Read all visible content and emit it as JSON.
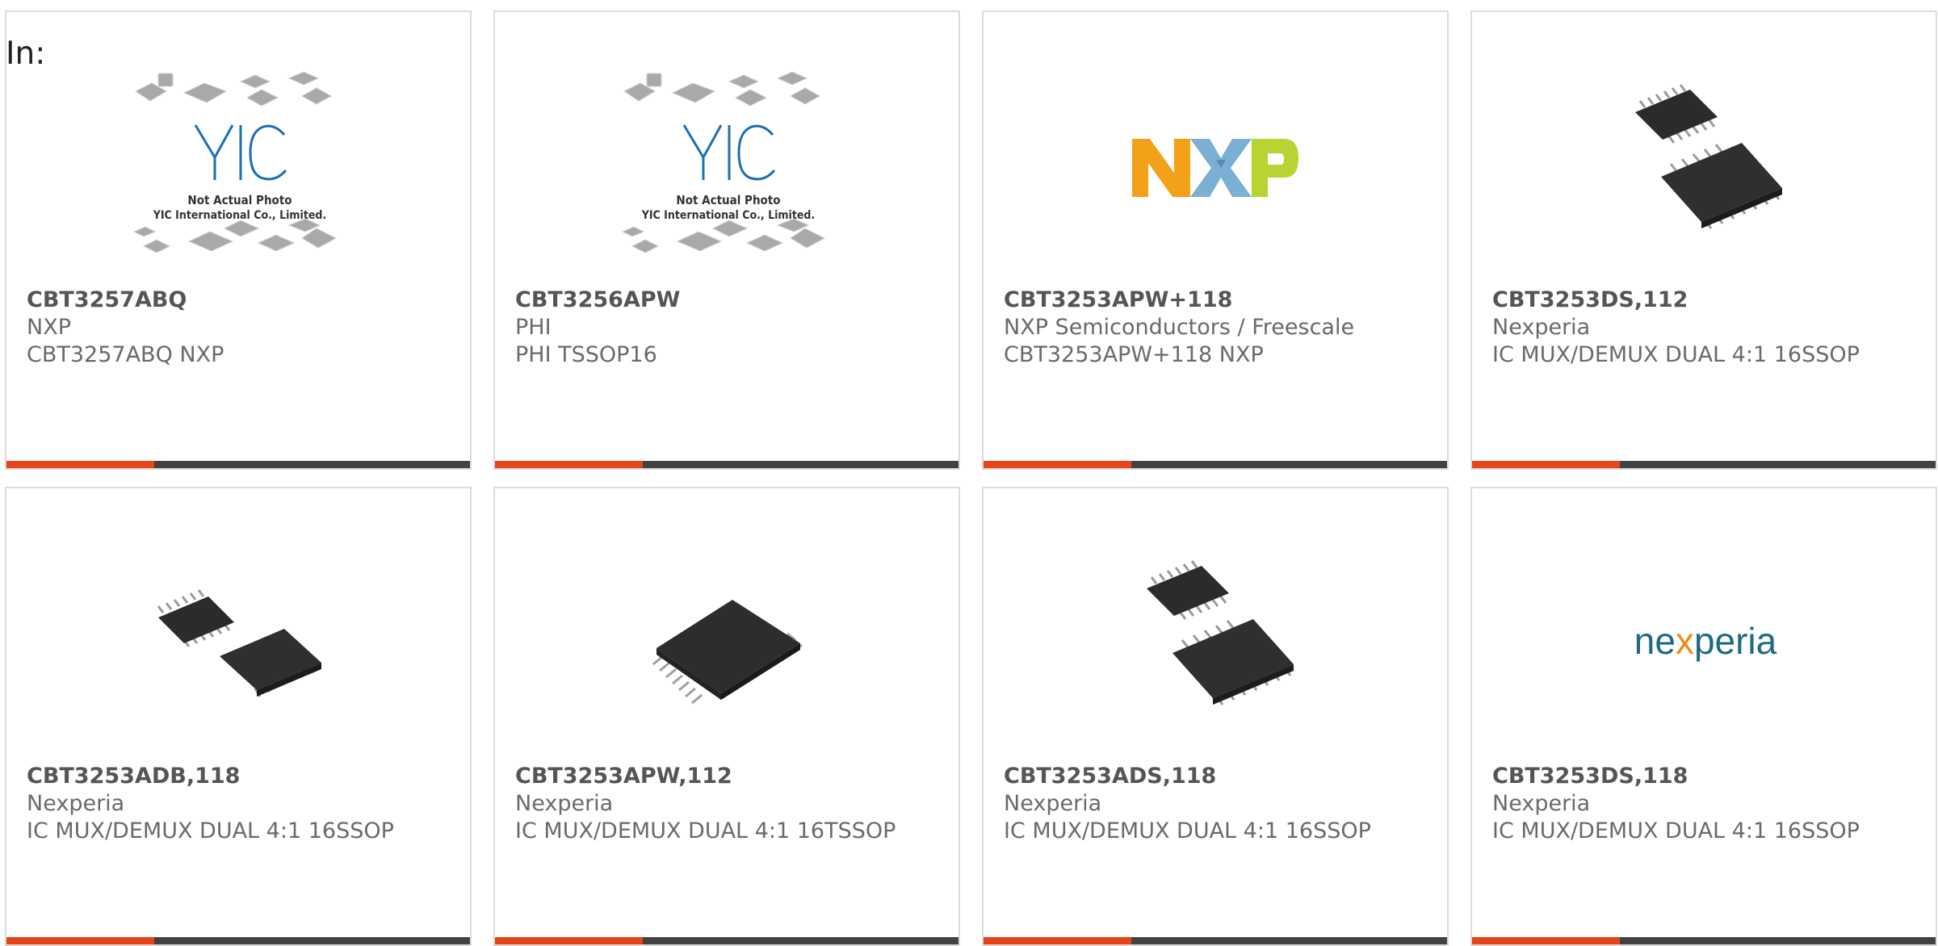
{
  "page": {
    "filter_label": "In:"
  },
  "accent_color": "#e8441a",
  "bar_color": "#424242",
  "products": [
    {
      "part": "CBT3257ABQ",
      "manufacturer": "NXP",
      "description": "CBT3257ABQ NXP",
      "image": "yic-placeholder",
      "placeholder": {
        "brand": "YIC",
        "line1": "Not Actual Photo",
        "line2": "YIC International Co., Limited."
      }
    },
    {
      "part": "CBT3256APW",
      "manufacturer": "PHI",
      "description": "PHI TSSOP16",
      "image": "yic-placeholder",
      "placeholder": {
        "brand": "YIC",
        "line1": "Not Actual Photo",
        "line2": "YIC International Co., Limited."
      }
    },
    {
      "part": "CBT3253APW+118",
      "manufacturer": "NXP Semiconductors / Freescale",
      "description": "CBT3253APW+118 NXP",
      "image": "nxp-logo",
      "logo_text": "NXP"
    },
    {
      "part": "CBT3253DS,112",
      "manufacturer": "Nexperia",
      "description": "IC MUX/DEMUX DUAL 4:1 16SSOP",
      "image": "ssop-two-chips"
    },
    {
      "part": "CBT3253ADB,118",
      "manufacturer": "Nexperia",
      "description": "IC MUX/DEMUX DUAL 4:1 16SSOP",
      "image": "ssop-two-chips-side"
    },
    {
      "part": "CBT3253APW,112",
      "manufacturer": "Nexperia",
      "description": "IC MUX/DEMUX DUAL 4:1 16TSSOP",
      "image": "tssop-single-chip"
    },
    {
      "part": "CBT3253ADS,118",
      "manufacturer": "Nexperia",
      "description": "IC MUX/DEMUX DUAL 4:1 16SSOP",
      "image": "ssop-two-chips"
    },
    {
      "part": "CBT3253DS,118",
      "manufacturer": "Nexperia",
      "description": "IC MUX/DEMUX DUAL 4:1 16SSOP",
      "image": "nexperia-logo",
      "logo_text": "nexperia"
    }
  ]
}
